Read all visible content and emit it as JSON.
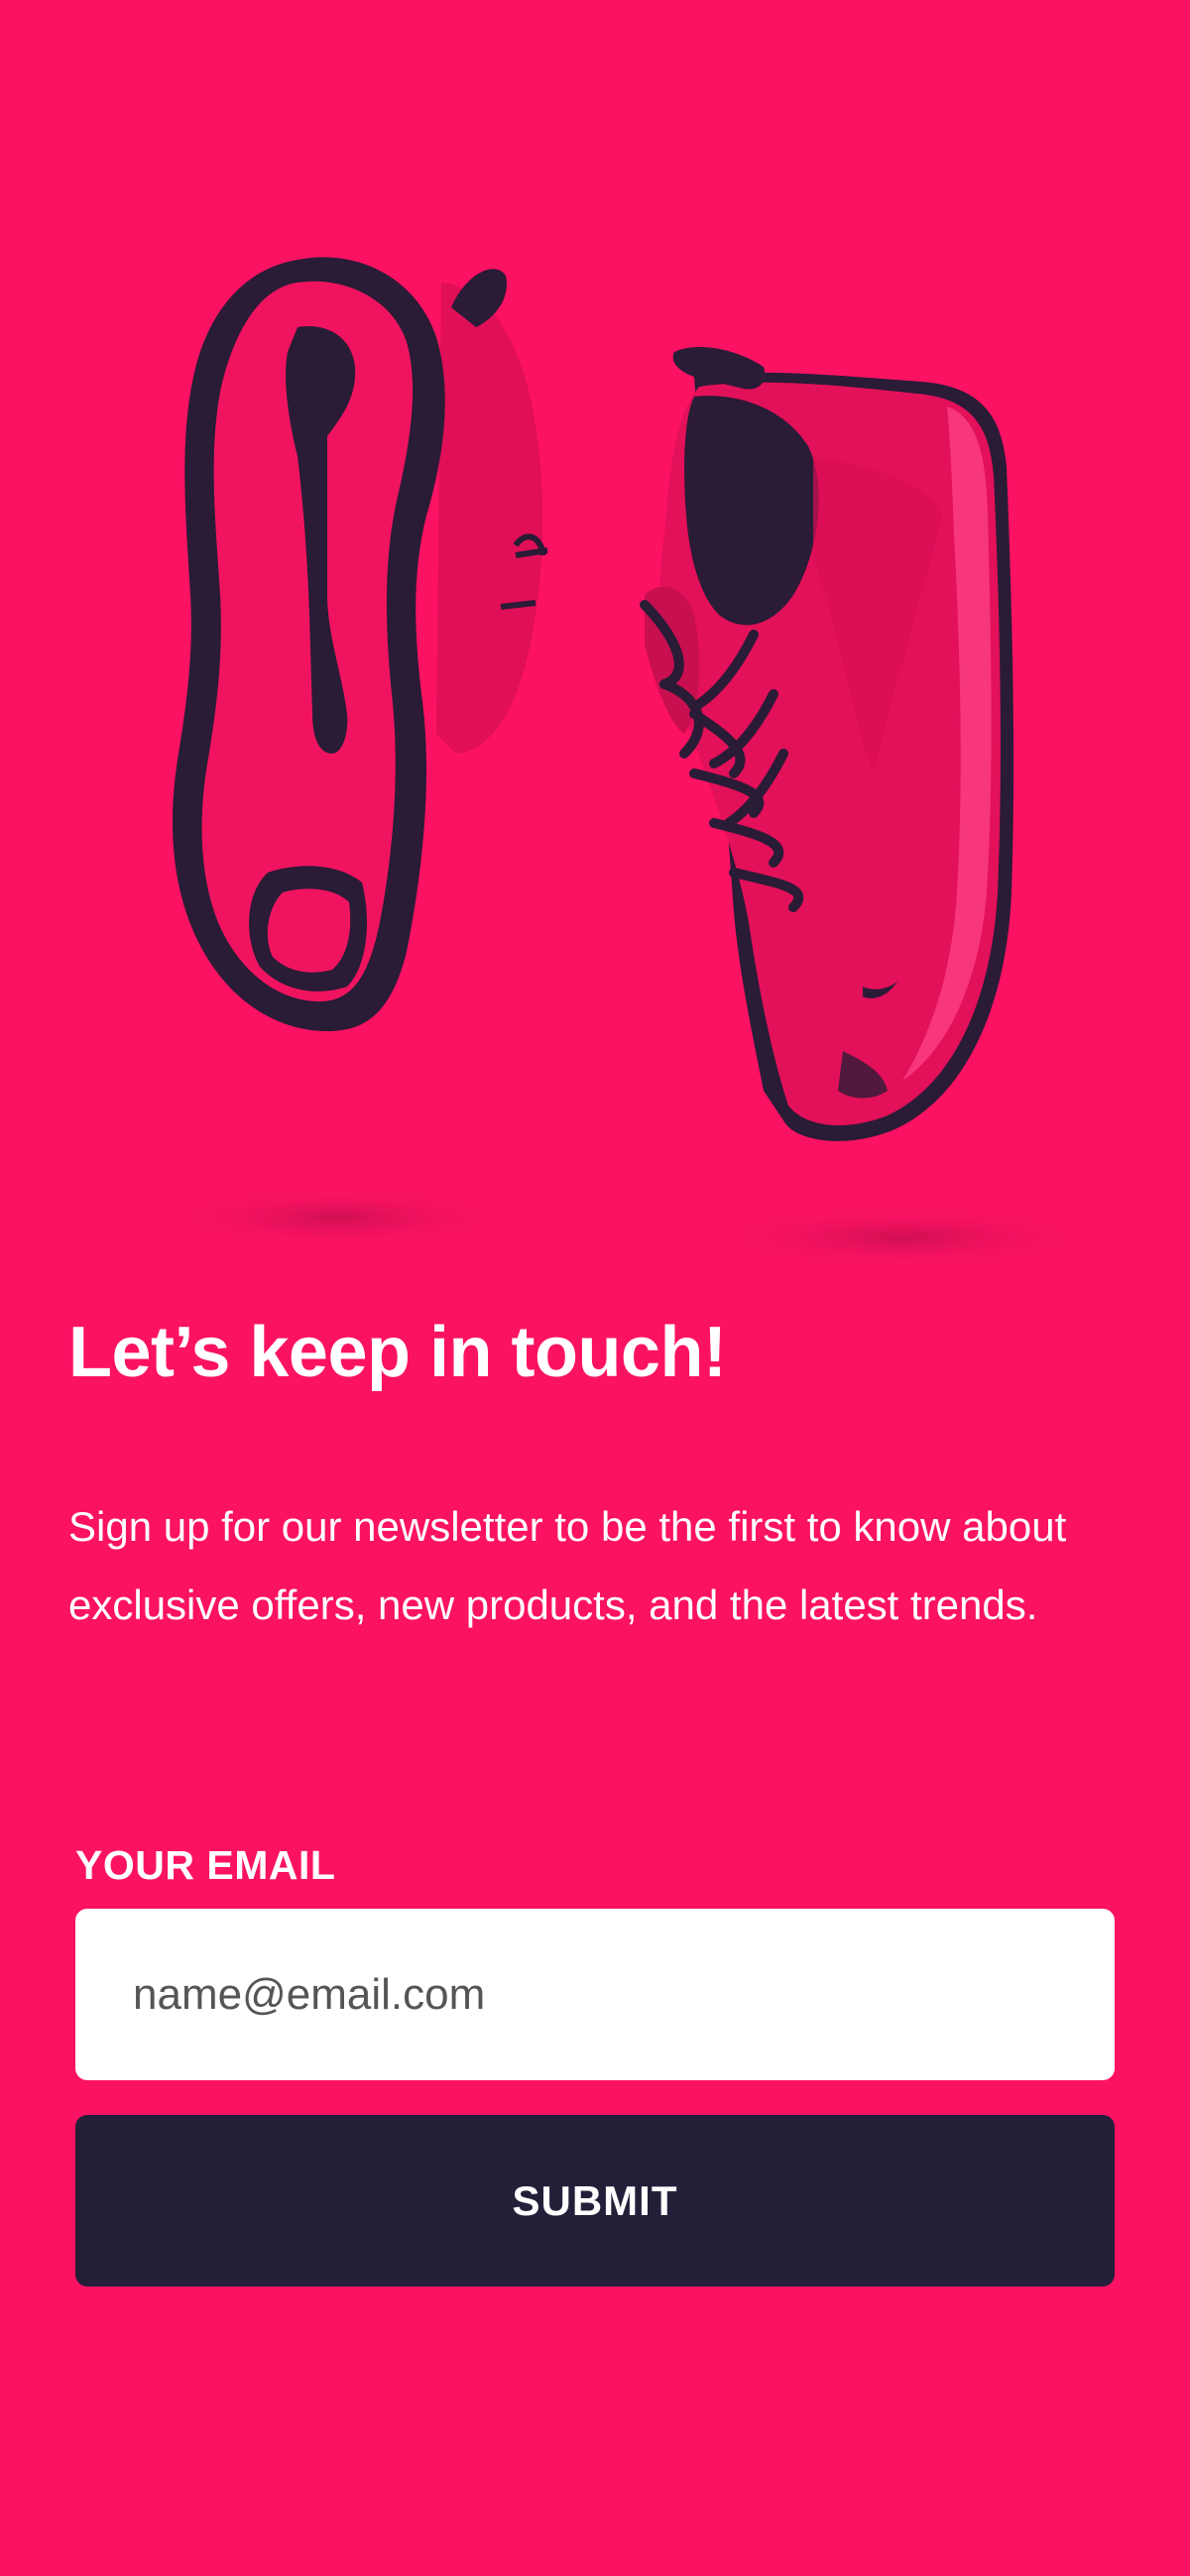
{
  "hero": {
    "image": "shoes-pair-illustration"
  },
  "content": {
    "title": "Let’s keep in touch!",
    "description": "Sign up for our newsletter to be the first to know about exclusive offers, new products, and the latest trends."
  },
  "form": {
    "email_label": "YOUR EMAIL",
    "email_placeholder": "name@email.com",
    "email_value": "",
    "submit_label": "SUBMIT"
  },
  "colors": {
    "background": "#fb1263",
    "button": "#251e39",
    "input_background": "#ffffff",
    "text": "#ffffff"
  }
}
